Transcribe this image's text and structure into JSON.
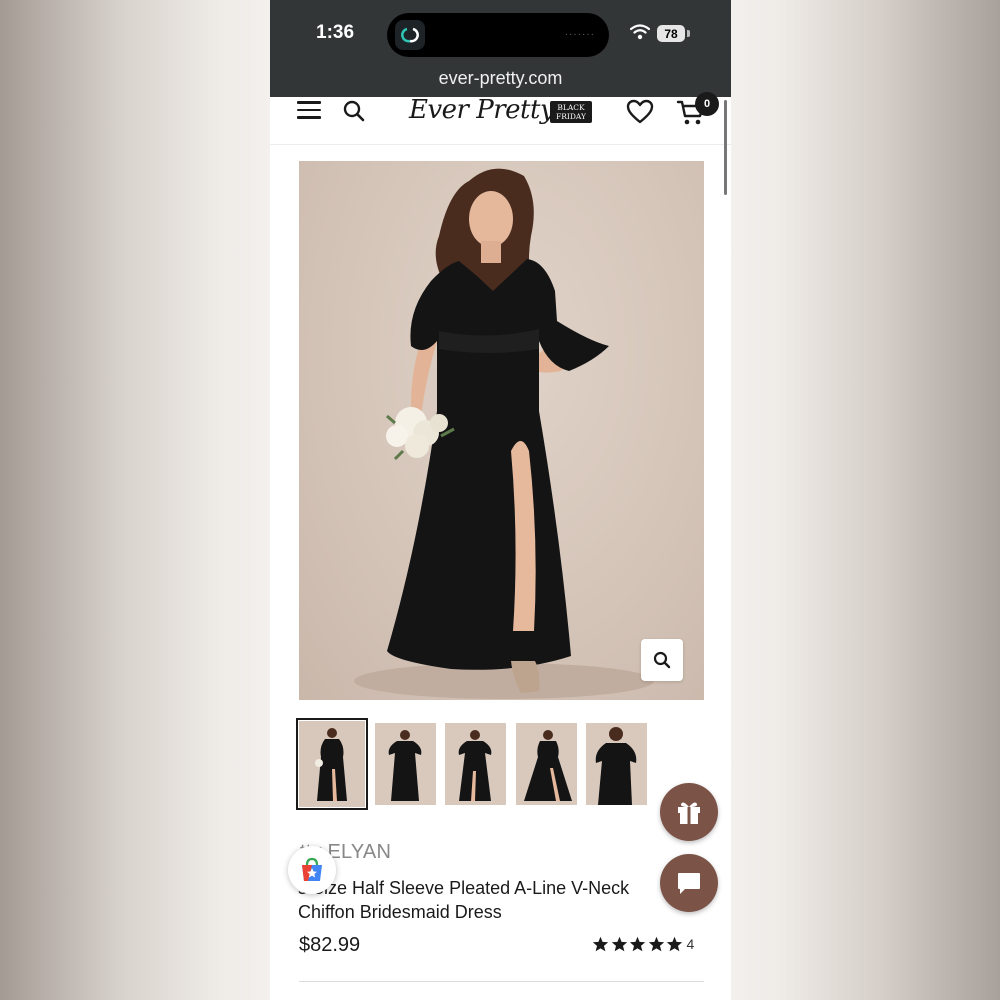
{
  "status_bar": {
    "time": "1:36",
    "battery": "78"
  },
  "browser": {
    "url": "ever-pretty.com"
  },
  "header": {
    "logo": "Ever Pretty",
    "promo_badge_line1": "BLACK",
    "promo_badge_line2": "FRIDAY",
    "cart_count": "0"
  },
  "gallery": {
    "thumbnail_count": 5,
    "active_index": 0
  },
  "product": {
    "brand": "tty ELYAN",
    "title_line1": "s Size Half Sleeve Pleated A-Line V-Neck",
    "title_line2": "Chiffon Bridesmaid Dress",
    "price": "$82.99",
    "rating": 5,
    "review_count": "4"
  },
  "colors": {
    "accent_brown": "#7b5447",
    "browser_chrome": "#333637",
    "dress": "#141414"
  },
  "icons": [
    "hamburger-icon",
    "search-icon",
    "heart-icon",
    "cart-icon",
    "zoom-icon",
    "gift-icon",
    "chat-icon",
    "shopping-bag-star-icon",
    "star-icon",
    "wifi-icon"
  ]
}
